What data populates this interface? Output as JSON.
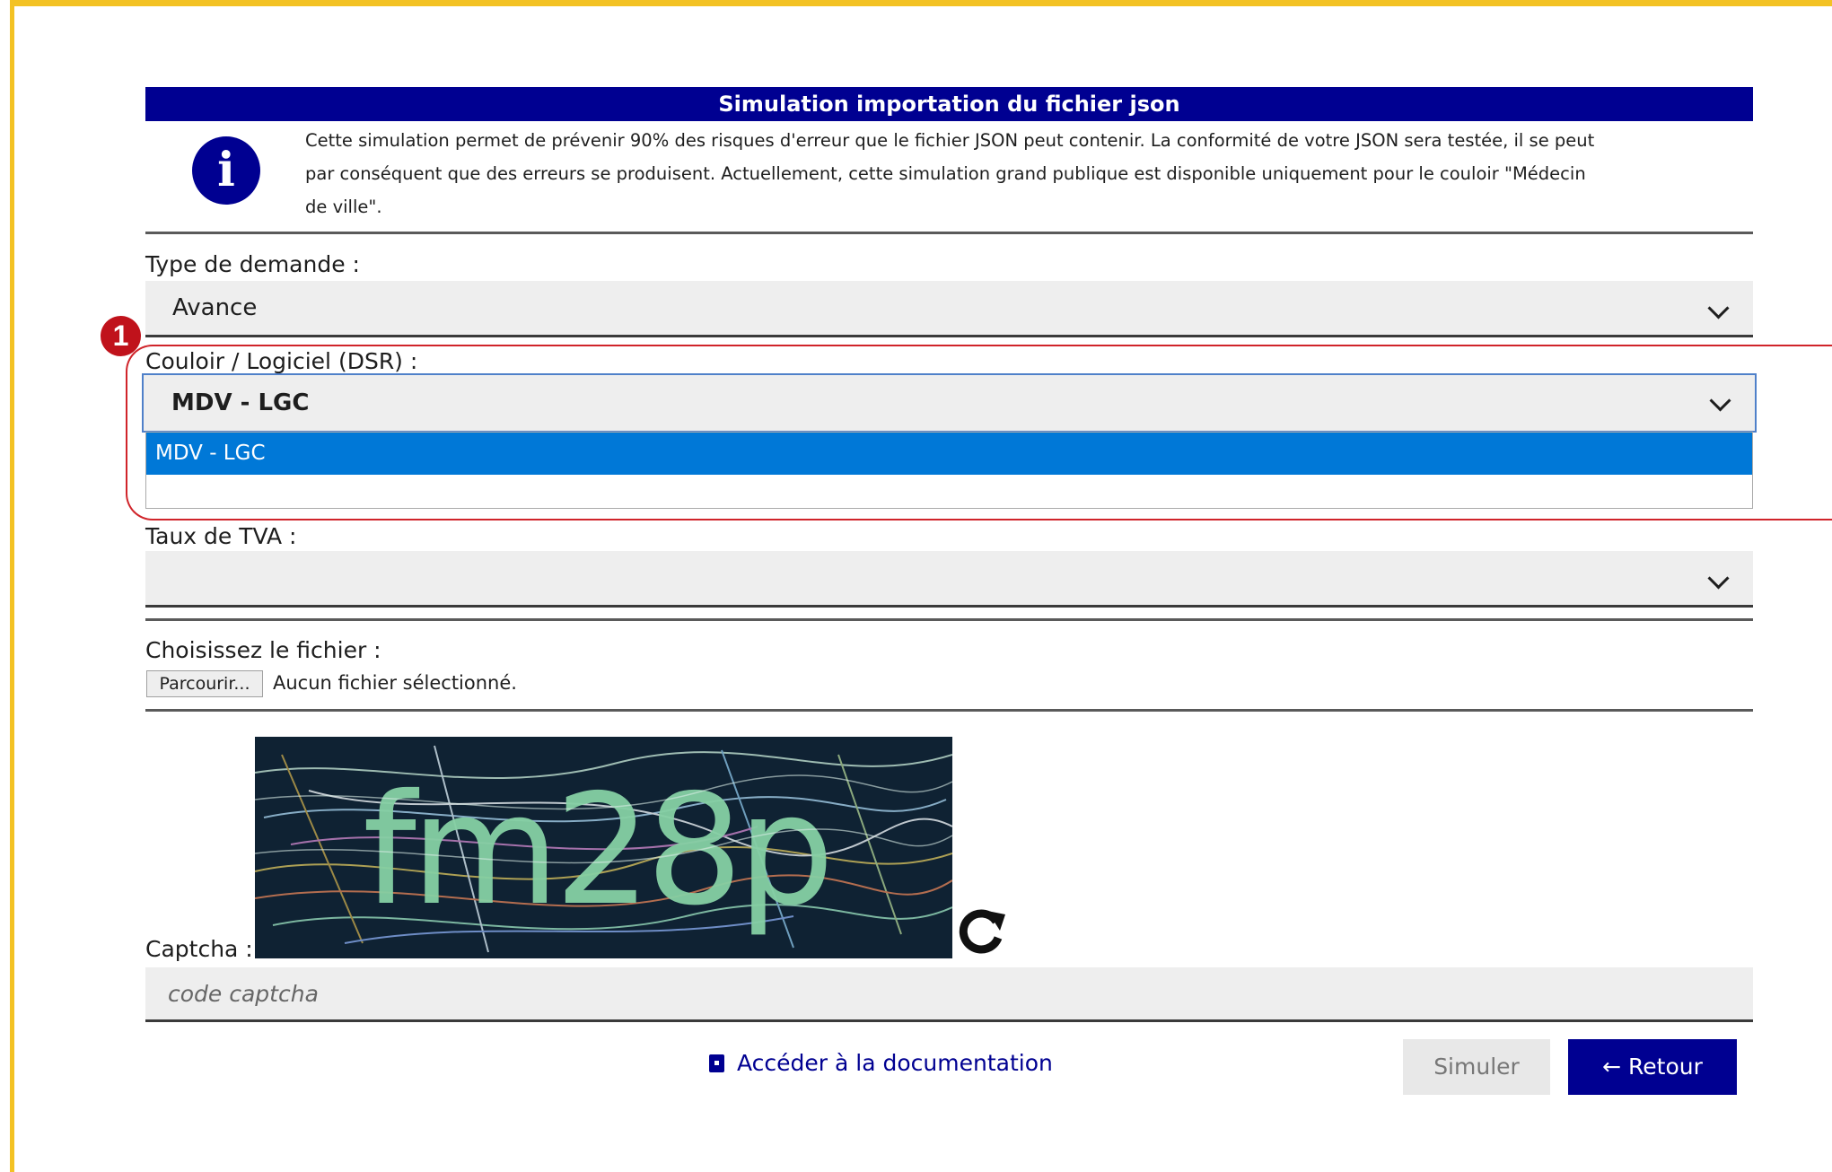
{
  "header": {
    "title": "Simulation importation du fichier json",
    "info_text": "Cette simulation permet de prévenir 90% des risques d'erreur que le fichier JSON peut contenir. La conformité de votre JSON sera testée, il se peut par conséquent que des erreurs se produisent. Actuellement, cette simulation grand publique est disponible uniquement pour le couloir \"Médecin de ville\".",
    "info_icon": "info-circle-icon"
  },
  "form": {
    "type_demande": {
      "label": "Type de demande :",
      "value": "Avance"
    },
    "couloir": {
      "label": "Couloir / Logiciel (DSR) :",
      "value": "MDV - LGC",
      "options": [
        "MDV - LGC"
      ]
    },
    "taux_tva": {
      "label": "Taux de TVA :",
      "value": ""
    },
    "fichier": {
      "label": "Choisissez le fichier :",
      "browse_label": "Parcourir...",
      "status": "Aucun fichier sélectionné."
    },
    "captcha": {
      "label": "Captcha :",
      "image_text": "fm28p",
      "placeholder": "code captcha",
      "refresh_icon": "refresh-icon"
    }
  },
  "annotation": {
    "badge": "1"
  },
  "footer": {
    "doc_link": "Accéder à la documentation",
    "simuler_label": "Simuler",
    "retour_label": "← Retour"
  },
  "colors": {
    "primary": "#000091",
    "frame": "#f3c224",
    "highlight": "#d0242a",
    "selected_option": "#0078d7"
  }
}
